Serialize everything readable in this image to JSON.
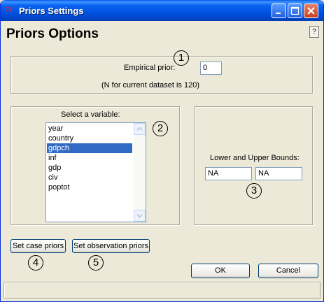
{
  "window": {
    "icon_text": "74",
    "title": "Priors Settings"
  },
  "page": {
    "heading": "Priors Options",
    "help_label": "?"
  },
  "empirical": {
    "label": "Empirical prior:",
    "value": "0",
    "note": "(N for current dataset is 120)"
  },
  "variables": {
    "label": "Select a variable:",
    "items": [
      "year",
      "country",
      "gdpch",
      "inf",
      "gdp",
      "civ",
      "poptot"
    ],
    "selected": "gdpch"
  },
  "bounds": {
    "label": "Lower and Upper Bounds:",
    "lower": "NA",
    "upper": "NA"
  },
  "buttons": {
    "case_priors": "Set case priors",
    "observation_priors": "Set observation priors",
    "ok": "OK",
    "cancel": "Cancel"
  },
  "callouts": [
    "1",
    "2",
    "3",
    "4",
    "5"
  ]
}
